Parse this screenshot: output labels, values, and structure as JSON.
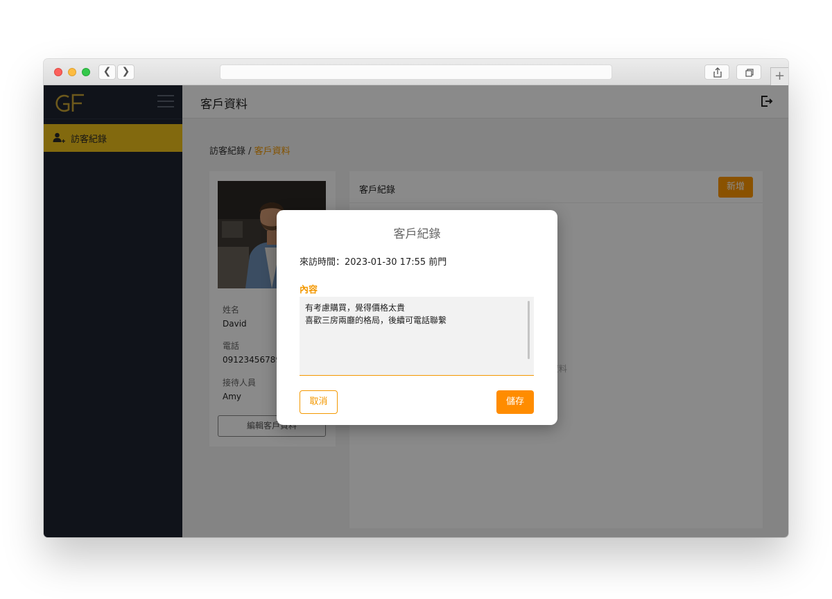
{
  "browser": {
    "back_glyph": "❮",
    "forward_glyph": "❯",
    "new_tab_glyph": "+"
  },
  "sidebar": {
    "logo_text": "GF",
    "items": [
      {
        "label": "訪客紀錄",
        "icon": "add-user-icon",
        "active": true
      }
    ]
  },
  "header": {
    "title": "客戶資料",
    "logout_icon": "logout-icon"
  },
  "breadcrumb": {
    "parent": "訪客紀錄",
    "separator": " / ",
    "current": "客戶資料"
  },
  "profile": {
    "name_label": "姓名",
    "name": "David",
    "phone_label": "電話",
    "phone": "09123456789",
    "staff_label": "接待人員",
    "staff": "Amy",
    "edit_button": "編輯客戶資料"
  },
  "records": {
    "title": "客戶紀錄",
    "add_button": "新增",
    "empty_text": "資料"
  },
  "dialog": {
    "title": "客戶紀錄",
    "visit_info": "來訪時間：2023-01-30  17:55 前門",
    "content_label": "內容",
    "content_lines": [
      "有考慮購買，覺得價格太貴",
      "喜歡三房兩廳的格局，後續可電話聯繫"
    ],
    "cancel_button": "取消",
    "save_button": "儲存"
  },
  "colors": {
    "accent": "#ff8c00",
    "sidebar_bg": "#1e2431",
    "sidebar_active": "#f0c21b"
  }
}
